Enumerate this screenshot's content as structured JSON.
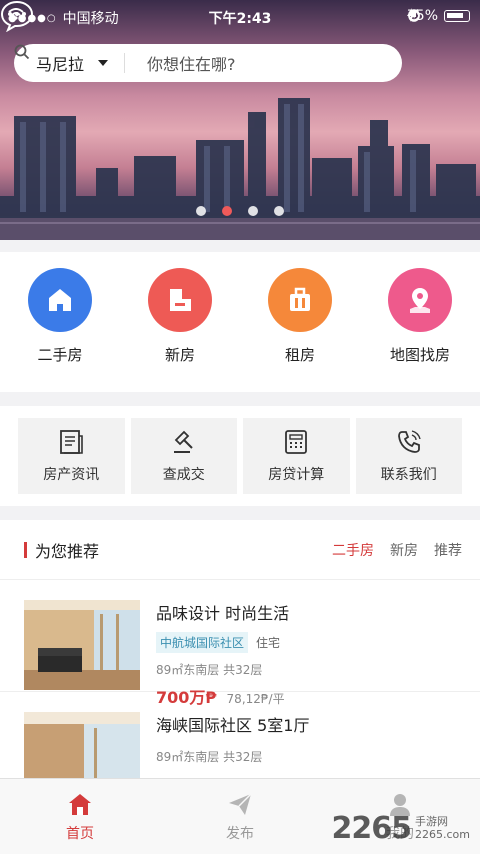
{
  "status_bar": {
    "signal": "●●●●○",
    "carrier": "中国移动",
    "time": "下午2:43",
    "battery": "75%"
  },
  "search": {
    "city": "马尼拉",
    "placeholder": "你想住在哪?"
  },
  "banner": {
    "dots": 4,
    "active_index": 1
  },
  "categories": [
    {
      "label": "二手房",
      "color": "#3b7be8",
      "icon": "house-icon"
    },
    {
      "label": "新房",
      "color": "#ee5a55",
      "icon": "building-icon"
    },
    {
      "label": "租房",
      "color": "#f5883a",
      "icon": "suitcase-icon"
    },
    {
      "label": "地图找房",
      "color": "#ee5a8c",
      "icon": "map-pin-icon"
    }
  ],
  "tools": [
    {
      "label": "房产资讯",
      "icon": "news-icon"
    },
    {
      "label": "查成交",
      "icon": "gavel-icon"
    },
    {
      "label": "房贷计算",
      "icon": "calculator-icon"
    },
    {
      "label": "联系我们",
      "icon": "phone-icon"
    }
  ],
  "recommend": {
    "title": "为您推荐",
    "tabs": [
      "二手房",
      "新房",
      "推荐"
    ],
    "active_tab": 0,
    "items": [
      {
        "title": "品味设计 时尚生活",
        "tag": "中航城国际社区",
        "type": "住宅",
        "meta": "89㎡东南层   共32层",
        "price": "700万₱",
        "unit_price": "78,12₱/平"
      },
      {
        "title": "海峡国际社区   5室1厅",
        "tag": "",
        "type": "",
        "meta": "89㎡东南层   共32层",
        "price": "",
        "unit_price": ""
      }
    ]
  },
  "tabbar": [
    {
      "label": "首页",
      "icon": "home-icon",
      "active": true
    },
    {
      "label": "发布",
      "icon": "send-icon",
      "active": false
    },
    {
      "label": "我的",
      "icon": "user-icon",
      "active": false
    }
  ],
  "watermark": {
    "number": "2265",
    "text1": "手游网",
    "text2": "2265.com"
  }
}
